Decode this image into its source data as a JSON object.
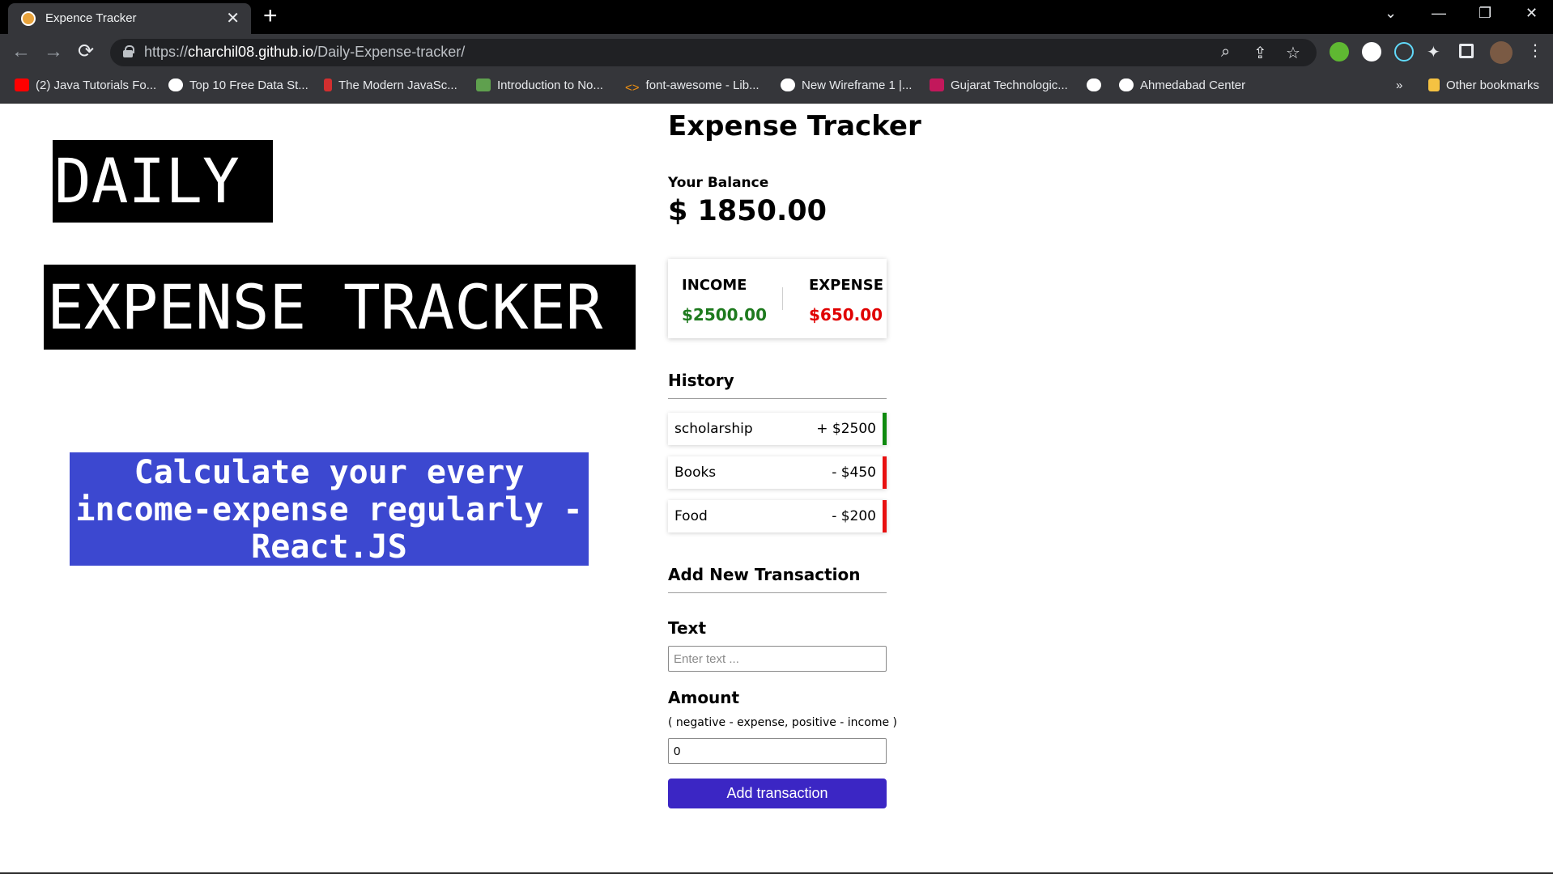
{
  "browser": {
    "tab_title": "Expence Tracker",
    "tab_close": "✕",
    "new_tab": "+",
    "url_scheme": "https://",
    "url_host": "charchil08.github.io",
    "url_path": "/Daily-Expense-tracker/",
    "bookmarks": [
      {
        "label": "(2) Java Tutorials Fo...",
        "icon": "youtube-icon",
        "color": "#ff0000"
      },
      {
        "label": "Top 10 Free Data St...",
        "icon": "medium-icon",
        "color": "#ffffff"
      },
      {
        "label": "The Modern JavaSc...",
        "icon": "javascript-info-icon",
        "color": "#d32f2f"
      },
      {
        "label": "Introduction to No...",
        "icon": "nodejs-icon",
        "color": "#5fa04e"
      },
      {
        "label": "font-awesome - Lib...",
        "icon": "code-icon",
        "color": "#f29111"
      },
      {
        "label": "New Wireframe 1 |...",
        "icon": "smiley-icon",
        "color": "#ffffff"
      },
      {
        "label": "Gujarat Technologic...",
        "icon": "gtu-icon",
        "color": "#c2185b"
      },
      {
        "label": "",
        "icon": "globe-icon",
        "color": "#ffffff"
      },
      {
        "label": "Ahmedabad Center",
        "icon": "globe-icon",
        "color": "#ffffff"
      }
    ],
    "bookmarks_overflow": "»",
    "other_bookmarks": "Other bookmarks"
  },
  "hero": {
    "line1": "DAILY",
    "line2": "EXPENSE TRACKER",
    "tagline": "Calculate your every income-expense regularly - React.JS"
  },
  "tracker": {
    "title": "Expense Tracker",
    "balance_label": "Your Balance",
    "balance_value": "$ 1850.00",
    "income_label": "INCOME",
    "income_value": "$2500.00",
    "expense_label": "EXPENSE",
    "expense_value": "$650.00",
    "history_title": "History",
    "history": [
      {
        "text": "scholarship",
        "amount": "+ $2500",
        "type": "income"
      },
      {
        "text": "Books",
        "amount": "- $450",
        "type": "expense"
      },
      {
        "text": "Food",
        "amount": "- $200",
        "type": "expense"
      }
    ],
    "add_title": "Add New Transaction",
    "text_label": "Text",
    "text_placeholder": "Enter text ...",
    "amount_label": "Amount",
    "amount_hint": "( negative - expense, positive - income )",
    "amount_value": "0",
    "add_button": "Add transaction"
  },
  "colors": {
    "income": "#1e7a1e",
    "expense": "#e00000",
    "income_bar": "#0e8a0e",
    "expense_bar": "#e81010",
    "button": "#3b26c4",
    "tagline_bg": "#3c48d0"
  }
}
